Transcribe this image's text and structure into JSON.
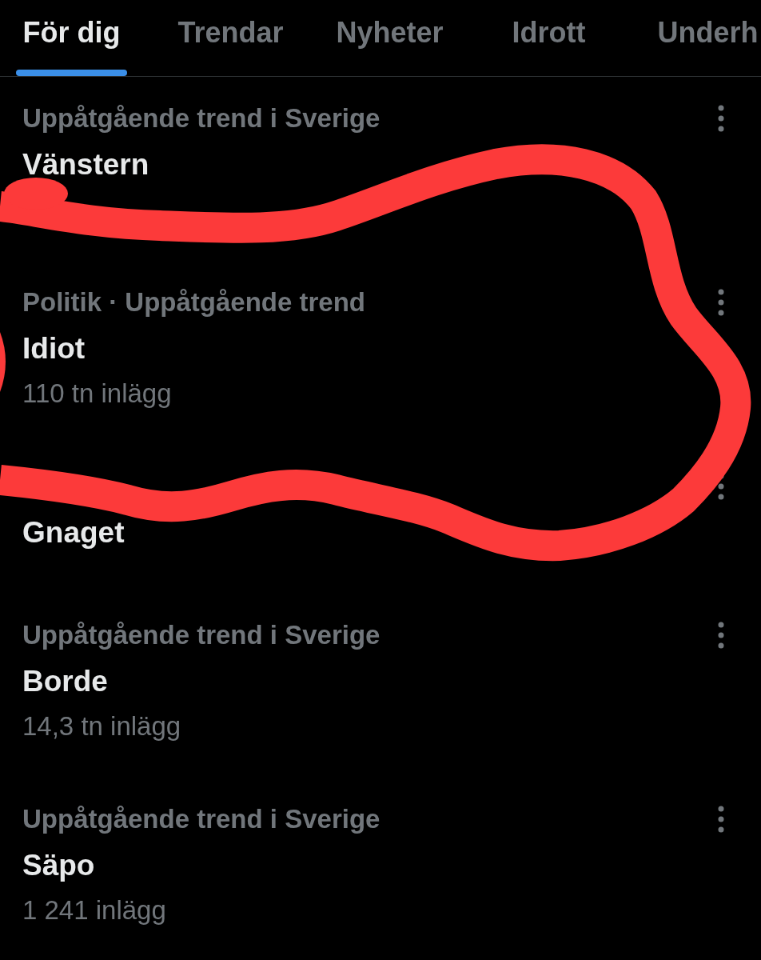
{
  "tabs": [
    {
      "label": "För dig",
      "selected": true
    },
    {
      "label": "Trendar",
      "selected": false
    },
    {
      "label": "Nyheter",
      "selected": false
    },
    {
      "label": "Idrott",
      "selected": false
    },
    {
      "label": "Underh",
      "selected": false
    }
  ],
  "trends": [
    {
      "category": "Uppåtgående trend i Sverige",
      "category_covered": false,
      "title": "Vänstern",
      "count_covered": true
    },
    {
      "category": "Politik · Uppåtgående trend",
      "category_covered": false,
      "title": "Idiot",
      "count": "110 tn inlägg",
      "count_covered": false
    },
    {
      "category_covered": true,
      "title": "Gnaget",
      "count_covered": false
    },
    {
      "category": "Uppåtgående trend i Sverige",
      "category_covered": false,
      "title": "Borde",
      "count": "14,3 tn inlägg",
      "count_covered": false
    },
    {
      "category": "Uppåtgående trend i Sverige",
      "category_covered": false,
      "title": "Säpo",
      "count": "1 241 inlägg",
      "count_covered": false
    }
  ]
}
